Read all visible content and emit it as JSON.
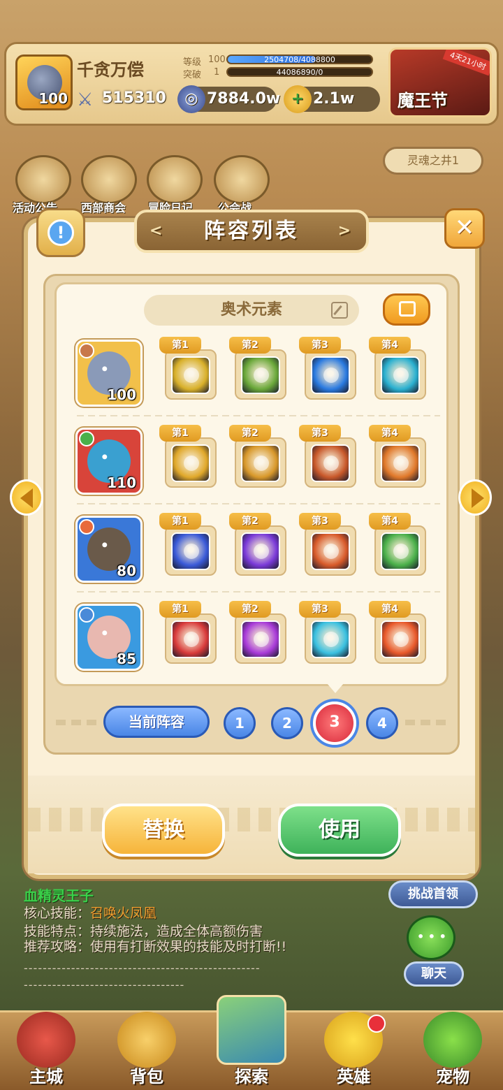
{
  "player": {
    "name": "千贪万偿",
    "level": "100",
    "power": "515310",
    "level_label": "等级",
    "level_num": "100",
    "exp_text": "2504708/4088800",
    "exp_progress": 0.61,
    "break_label": "突破",
    "break_num": "1",
    "break_text": "44086890/0",
    "break_progress": 0.0
  },
  "resources": {
    "currency1": "7884.0w",
    "currency2": "2.1w"
  },
  "event": {
    "label": "魔王节",
    "tag": "4天21小时"
  },
  "background_menu": {
    "items": [
      "活动公告",
      "西部商会",
      "冒险日记",
      "公会战"
    ],
    "well_label": "灵魂之井1"
  },
  "modal": {
    "title": "阵容列表",
    "formation_name": "奥术元素",
    "heroes": [
      {
        "level": "100",
        "element_color": "#c8784a",
        "bg": "#f2c04a",
        "face": "#8a9ab8",
        "skills": [
          {
            "tag": "第1",
            "color": "#d8b02a"
          },
          {
            "tag": "第2",
            "color": "#6aa83a"
          },
          {
            "tag": "第3",
            "color": "#2a7ae0"
          },
          {
            "tag": "第4",
            "color": "#2ab0d0"
          }
        ]
      },
      {
        "level": "110",
        "element_color": "#4ab04a",
        "bg": "#d8443a",
        "face": "#3aa0d0",
        "skills": [
          {
            "tag": "第1",
            "color": "#e0a82a"
          },
          {
            "tag": "第2",
            "color": "#d8982a"
          },
          {
            "tag": "第3",
            "color": "#c8582a"
          },
          {
            "tag": "第4",
            "color": "#e0782a"
          }
        ]
      },
      {
        "level": "80",
        "element_color": "#e86a3a",
        "bg": "#3a78d8",
        "face": "#6a5a4a",
        "skills": [
          {
            "tag": "第1",
            "color": "#3a5ad8"
          },
          {
            "tag": "第2",
            "color": "#7a3ad8"
          },
          {
            "tag": "第3",
            "color": "#d85a2a"
          },
          {
            "tag": "第4",
            "color": "#4ab04a"
          }
        ]
      },
      {
        "level": "85",
        "element_color": "#4a8ad8",
        "bg": "#3a9ae0",
        "face": "#e8b8b0",
        "skills": [
          {
            "tag": "第1",
            "color": "#d83a3a"
          },
          {
            "tag": "第2",
            "color": "#a83ad8"
          },
          {
            "tag": "第3",
            "color": "#3ac0e0"
          },
          {
            "tag": "第4",
            "color": "#e8582a"
          }
        ]
      }
    ],
    "current_lineup_label": "当前阵容",
    "slots": [
      "1",
      "2",
      "3",
      "4"
    ],
    "active_slot": "3",
    "replace_label": "替换",
    "use_label": "使用"
  },
  "boss_info": {
    "name": "血精灵王子",
    "core_skill_label": "核心技能：",
    "core_skill": "召唤火凤凰",
    "trait_label": "技能特点：",
    "trait": "持续施法，造成全体高额伤害",
    "strategy_label": "推荐攻略：",
    "strategy": "使用有打断效果的技能及时打断!!",
    "dash1": "--------------------------------------------------",
    "dash2": "----------------------------------",
    "challenge_label": "挑战首领",
    "chat_label": "聊天"
  },
  "nav": {
    "items": [
      "主城",
      "背包",
      "探索",
      "英雄",
      "宠物"
    ],
    "active": "探索"
  }
}
